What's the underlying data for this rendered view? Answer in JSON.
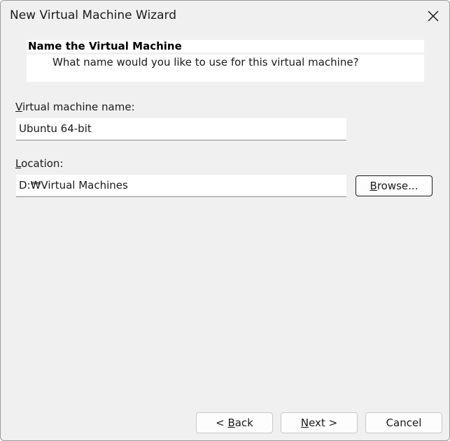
{
  "window": {
    "title": "New Virtual Machine Wizard"
  },
  "header": {
    "title": "Name the Virtual Machine",
    "subtitle": "What name would you like to use for this virtual machine?"
  },
  "form": {
    "vm_name": {
      "label_accel": "V",
      "label_rest": "irtual machine name:",
      "value": "Ubuntu 64-bit"
    },
    "location": {
      "label_accel": "L",
      "label_rest": "ocation:",
      "value": "D:₩Virtual Machines",
      "browse_accel": "B",
      "browse_rest": "rowse..."
    }
  },
  "footer": {
    "back_prefix": "< ",
    "back_accel": "B",
    "back_rest": "ack",
    "next_accel": "N",
    "next_rest": "ext >",
    "cancel_label": "Cancel"
  },
  "icons": {
    "close": "close-icon"
  }
}
